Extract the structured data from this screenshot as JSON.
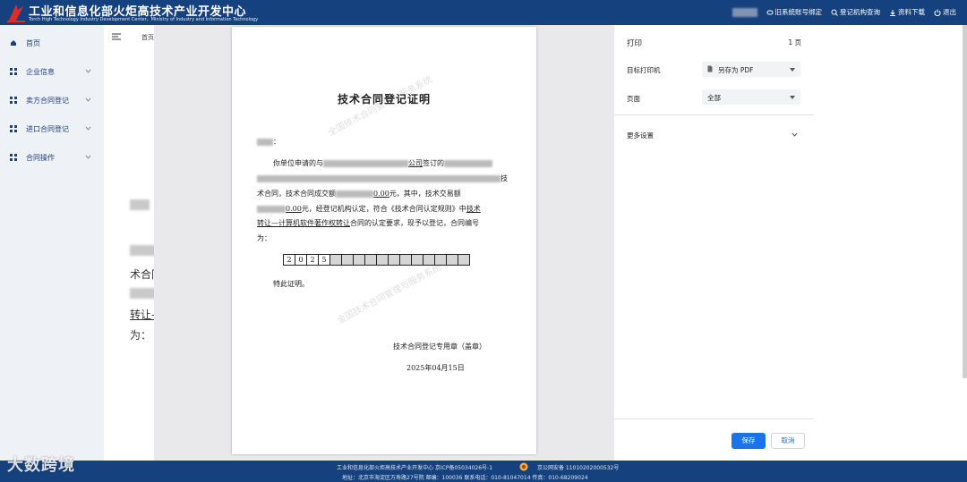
{
  "header": {
    "title_cn": "工业和信息化部火炬高技术产业开发中心",
    "title_en": "Torch High Technology Industry Development Center，Ministry of Industry and Information Technology",
    "actions": [
      "旧系统账号绑定",
      "登记机构查询",
      "资料下载",
      "退出"
    ]
  },
  "sidebar": {
    "items": [
      {
        "label": "首页",
        "icon": "home-icon",
        "expandable": false
      },
      {
        "label": "企业信息",
        "icon": "grid-icon",
        "expandable": true
      },
      {
        "label": "卖方合同登记",
        "icon": "grid-icon",
        "expandable": true
      },
      {
        "label": "进口合同登记",
        "icon": "grid-icon",
        "expandable": true
      },
      {
        "label": "合同操作",
        "icon": "grid-icon",
        "expandable": true
      }
    ]
  },
  "background": {
    "tab_label": "首页",
    "partial_texts": [
      "术合同",
      "转让-",
      "为："
    ]
  },
  "certificate": {
    "title": "技术合同登记证明",
    "salutation_suffix": "：",
    "line1_prefix": "你单位申请的与",
    "line1_company_suffix": "公司",
    "line1_mid": "签订的",
    "line2_suffix": "技",
    "line3_a": "术合同，技术合同成交额",
    "line3_amount": "0.00",
    "line3_b": "元，其中，技术交易额",
    "line4_amount": "0.00",
    "line4_a": "元，经登记机构认定，符合《技术合同认定规则》中",
    "line4_link": "技术",
    "line5_link": "转让—计算机软件著作权转让",
    "line5_a": "合同的认定要求，现予以登记，合同编号",
    "line6": "为：",
    "contract_digits": [
      "2",
      "0",
      "2",
      "5",
      "",
      "",
      "",
      "",
      "",
      "",
      "",
      "",
      "",
      "",
      "",
      ""
    ],
    "special": "特此证明。",
    "seal_text": "技术合同登记专用章（盖章）",
    "date": "2025年04月15日",
    "watermark": "全国技术合同管理与服务系统"
  },
  "print_settings": {
    "title": "打印",
    "pages_count": "1 页",
    "printer_label": "目标打印机",
    "printer_value": "另存为 PDF",
    "pages_label": "页面",
    "pages_value": "全部",
    "more_settings": "更多设置",
    "save_label": "保存",
    "cancel_label": "取消"
  },
  "footer": {
    "line1": "工业和信息化部火炬高技术产业开发中心  京ICP备05034026号-1",
    "line1b": "京公网安备 11010202000532号",
    "line2": "地址：北京市海淀区万寿路27号院 邮编：100036 联系电话：010-81047014     传真：010-68209024"
  },
  "watermark_brand": "大数跨境",
  "colors": {
    "header_bg": "#15427e",
    "accent": "#1a73e8",
    "sidebar_bg": "#eef1f6",
    "overlay_bg": "#e9e9eb"
  }
}
